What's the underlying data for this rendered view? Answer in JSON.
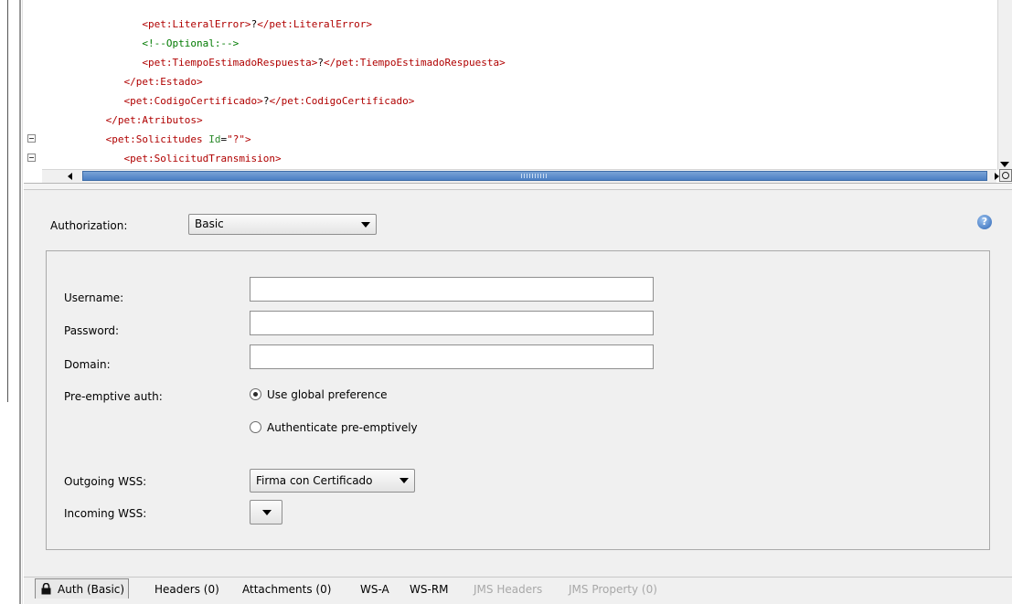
{
  "editor": {
    "lines": [
      {
        "indent": "               ",
        "parts": [
          {
            "c": "tag",
            "t": "<pet:LiteralError>"
          },
          {
            "c": "txt",
            "t": "?"
          },
          {
            "c": "tag",
            "t": "</pet:LiteralError>"
          }
        ]
      },
      {
        "indent": "               ",
        "parts": [
          {
            "c": "cmt",
            "t": "<!--Optional:-->"
          }
        ]
      },
      {
        "indent": "               ",
        "parts": [
          {
            "c": "tag",
            "t": "<pet:TiempoEstimadoRespuesta>"
          },
          {
            "c": "txt",
            "t": "?"
          },
          {
            "c": "tag",
            "t": "</pet:TiempoEstimadoRespuesta>"
          }
        ]
      },
      {
        "indent": "            ",
        "parts": [
          {
            "c": "tag",
            "t": "</pet:Estado>"
          }
        ]
      },
      {
        "indent": "            ",
        "parts": [
          {
            "c": "tag",
            "t": "<pet:CodigoCertificado>"
          },
          {
            "c": "txt",
            "t": "?"
          },
          {
            "c": "tag",
            "t": "</pet:CodigoCertificado>"
          }
        ]
      },
      {
        "indent": "         ",
        "parts": [
          {
            "c": "tag",
            "t": "</pet:Atributos>"
          }
        ]
      },
      {
        "indent": "         ",
        "parts": [
          {
            "c": "tag",
            "t": "<pet:Solicitudes "
          },
          {
            "c": "attr",
            "t": "Id"
          },
          {
            "c": "txt",
            "t": "="
          },
          {
            "c": "val",
            "t": "\"?\""
          },
          {
            "c": "tag",
            "t": ">"
          }
        ]
      },
      {
        "indent": "            ",
        "parts": [
          {
            "c": "tag",
            "t": "<pet:SolicitudTransmision>"
          }
        ]
      }
    ]
  },
  "auth": {
    "authorization_label": "Authorization:",
    "authorization_value": "Basic",
    "username_label": "Username:",
    "password_label": "Password:",
    "domain_label": "Domain:",
    "preemptive_label": "Pre-emptive auth:",
    "radio_global": "Use global preference",
    "radio_preemptive": "Authenticate pre-emptively",
    "outgoing_wss_label": "Outgoing WSS:",
    "outgoing_wss_value": "Firma con Certificado",
    "incoming_wss_label": "Incoming WSS:",
    "incoming_wss_value": "",
    "username_value": "",
    "password_value": "",
    "domain_value": ""
  },
  "tabs": {
    "auth": "Auth (Basic)",
    "headers": "Headers (0)",
    "attachments": "Attachments (0)",
    "wsa": "WS-A",
    "wsrm": "WS-RM",
    "jms_headers": "JMS Headers",
    "jms_property": "JMS Property (0)"
  },
  "icons": {
    "help": "help-icon",
    "lock": "lock-icon"
  }
}
